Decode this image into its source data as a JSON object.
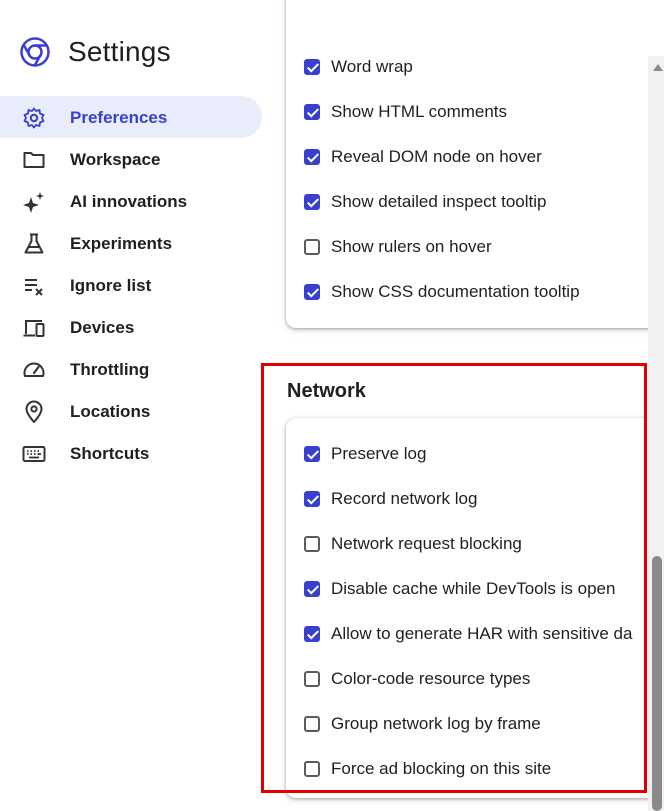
{
  "header": {
    "title": "Settings"
  },
  "sidebar": {
    "items": [
      {
        "label": "Preferences",
        "icon": "gear-icon",
        "active": true
      },
      {
        "label": "Workspace",
        "icon": "folder-icon"
      },
      {
        "label": "AI innovations",
        "icon": "sparkle-icon"
      },
      {
        "label": "Experiments",
        "icon": "flask-icon"
      },
      {
        "label": "Ignore list",
        "icon": "ignore-list-icon"
      },
      {
        "label": "Devices",
        "icon": "devices-icon"
      },
      {
        "label": "Throttling",
        "icon": "speedometer-icon"
      },
      {
        "label": "Locations",
        "icon": "location-pin-icon"
      },
      {
        "label": "Shortcuts",
        "icon": "keyboard-icon"
      }
    ]
  },
  "elements_section": {
    "options": [
      {
        "label": "Word wrap",
        "checked": true
      },
      {
        "label": "Show HTML comments",
        "checked": true
      },
      {
        "label": "Reveal DOM node on hover",
        "checked": true
      },
      {
        "label": "Show detailed inspect tooltip",
        "checked": true
      },
      {
        "label": "Show rulers on hover",
        "checked": false
      },
      {
        "label": "Show CSS documentation tooltip",
        "checked": true
      }
    ]
  },
  "network_section": {
    "title": "Network",
    "options": [
      {
        "label": "Preserve log",
        "checked": true
      },
      {
        "label": "Record network log",
        "checked": true
      },
      {
        "label": "Network request blocking",
        "checked": false
      },
      {
        "label": "Disable cache while DevTools is open",
        "checked": true
      },
      {
        "label": "Allow to generate HAR with sensitive da",
        "checked": true
      },
      {
        "label": "Color-code resource types",
        "checked": false
      },
      {
        "label": "Group network log by frame",
        "checked": false
      },
      {
        "label": "Force ad blocking on this site",
        "checked": false
      }
    ]
  },
  "colors": {
    "accent": "#3b3fcf",
    "active_bg": "#e8ecfb",
    "highlight": "#e00000"
  }
}
